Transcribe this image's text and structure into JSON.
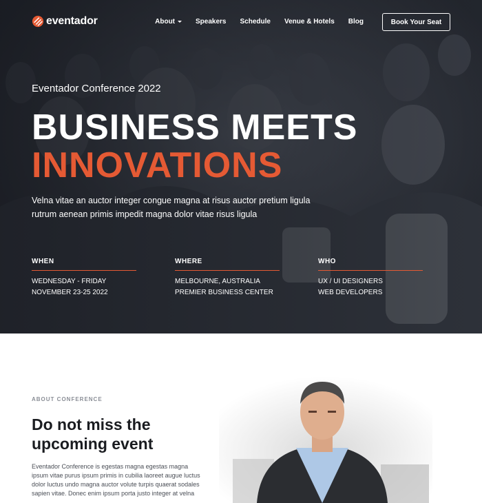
{
  "brand": {
    "name": "eventador",
    "accent": "#e55a34"
  },
  "nav": {
    "items": [
      "About",
      "Speakers",
      "Schedule",
      "Venue & Hotels",
      "Blog"
    ],
    "cta": "Book Your Seat"
  },
  "hero": {
    "eyebrow": "Eventador Conference 2022",
    "headline_1": "BUSINESS MEETS",
    "headline_2": "INNOVATIONS",
    "lede": "Velna vitae an auctor integer congue magna at risus auctor pretium ligula rutrum aenean primis impedit magna dolor vitae risus ligula",
    "info": [
      {
        "label": "WHEN",
        "lines": [
          "WEDNESDAY - FRIDAY",
          "NOVEMBER 23-25 2022"
        ]
      },
      {
        "label": "WHERE",
        "lines": [
          "MELBOURNE, AUSTRALIA",
          "PREMIER BUSINESS CENTER"
        ]
      },
      {
        "label": "WHO",
        "lines": [
          "UX / UI DESIGNERS",
          "WEB DEVELOPERS"
        ]
      }
    ]
  },
  "about": {
    "kicker": "ABOUT CONFERENCE",
    "title": "Do not miss the upcoming event",
    "text": "Eventador Conference is egestas magna egestas magna ipsum vitae purus ipsum primis in cubilia laoreet augue luctus dolor luctus undo magna auctor volute turpis quaerat sodales sapien vitae. Donec enim ipsum porta justo integer at velna"
  }
}
